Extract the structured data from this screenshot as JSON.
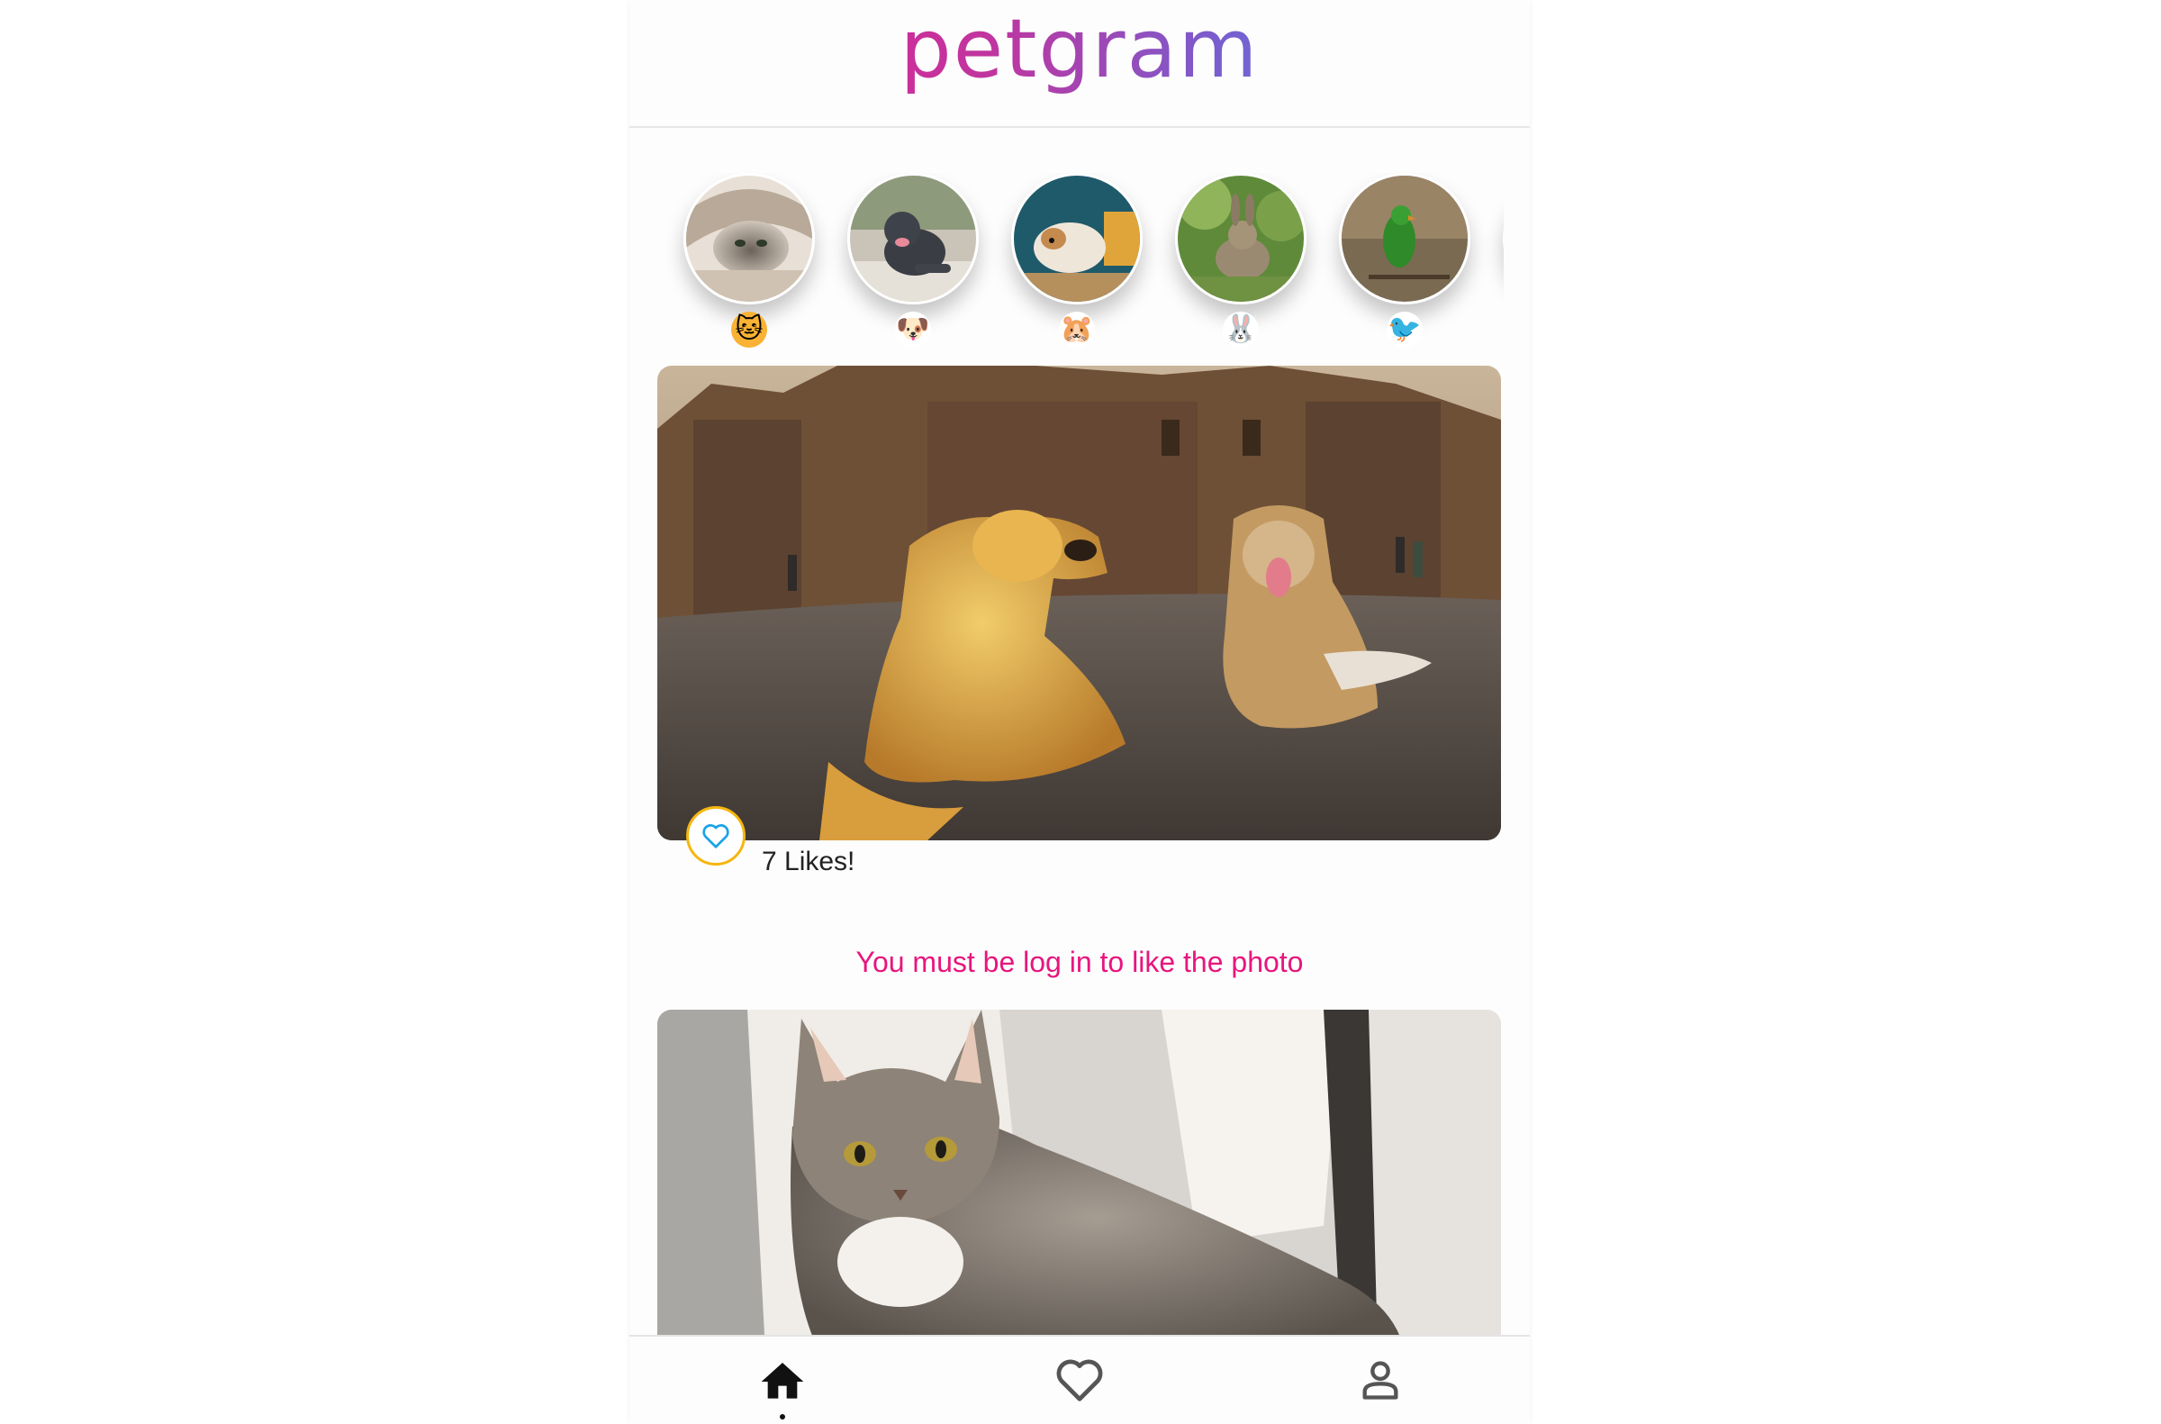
{
  "app": {
    "logo": "petgram"
  },
  "stories": [
    {
      "name": "cats",
      "emoji": "🐱",
      "emoji_icon": "cat-face-icon",
      "emoji_bg": "#f9b233"
    },
    {
      "name": "dogs",
      "emoji": "🐶",
      "emoji_icon": "dog-face-icon",
      "emoji_bg": "#ffffff"
    },
    {
      "name": "hamsters",
      "emoji": "🐹",
      "emoji_icon": "hamster-face-icon",
      "emoji_bg": "#ffffff"
    },
    {
      "name": "rabbits",
      "emoji": "🐰",
      "emoji_icon": "rabbit-face-icon",
      "emoji_bg": "#ffffff"
    },
    {
      "name": "birds",
      "emoji": "🐦",
      "emoji_icon": "bird-icon",
      "emoji_bg": "#ffffff"
    }
  ],
  "feed": {
    "post1": {
      "likes_text": "7 Likes!",
      "image_desc": "two-dogs-photo"
    },
    "login_message": "You must be log in to like the photo",
    "post2": {
      "image_desc": "tabby-cat-photo"
    }
  },
  "navbar": {
    "items": [
      {
        "name": "home",
        "icon": "home-icon",
        "active": true
      },
      {
        "name": "favorites",
        "icon": "heart-icon",
        "active": false
      },
      {
        "name": "user",
        "icon": "user-icon",
        "active": false
      }
    ]
  },
  "colors": {
    "accent_pink": "#e8157e",
    "like_ring": "#f5b60f",
    "heart_blue": "#1aa3e8"
  }
}
